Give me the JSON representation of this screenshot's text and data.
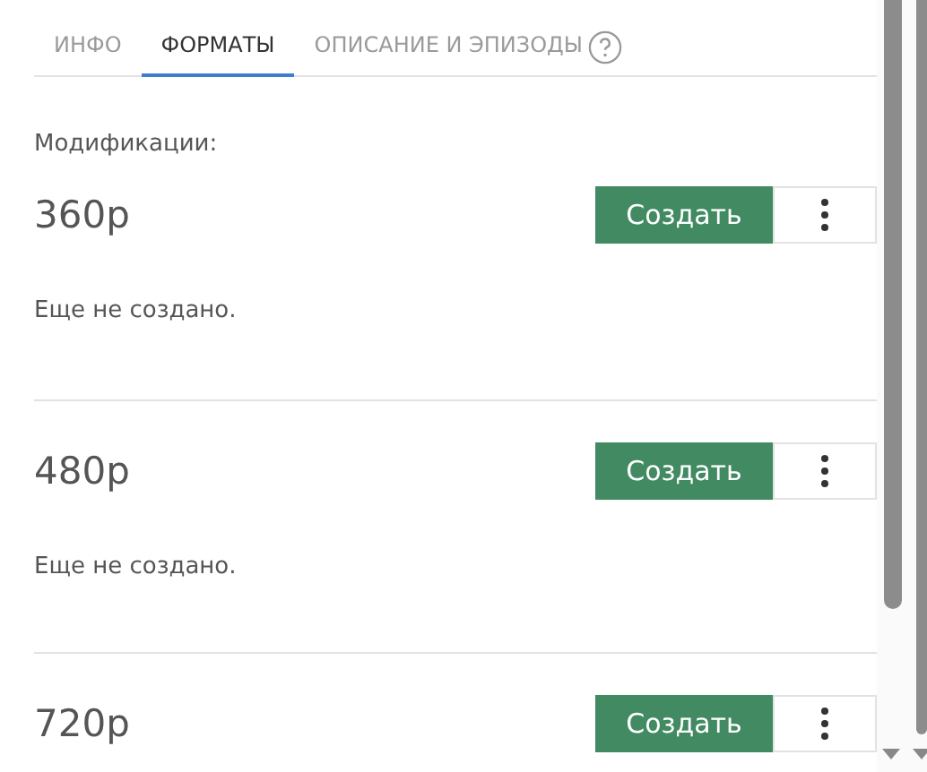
{
  "tabs": [
    {
      "label": "ИНФО",
      "selected": false
    },
    {
      "label": "ФОРМАТЫ",
      "selected": true
    },
    {
      "label": "ОПИСАНИЕ И ЭПИЗОДЫ",
      "selected": false,
      "help": true
    }
  ],
  "section_label": "Модификации:",
  "modifications": [
    {
      "name": "360p",
      "button": "Создать",
      "status": "Еще не создано."
    },
    {
      "name": "480p",
      "button": "Создать",
      "status": "Еще не создано."
    },
    {
      "name": "720p",
      "button": "Создать"
    }
  ]
}
